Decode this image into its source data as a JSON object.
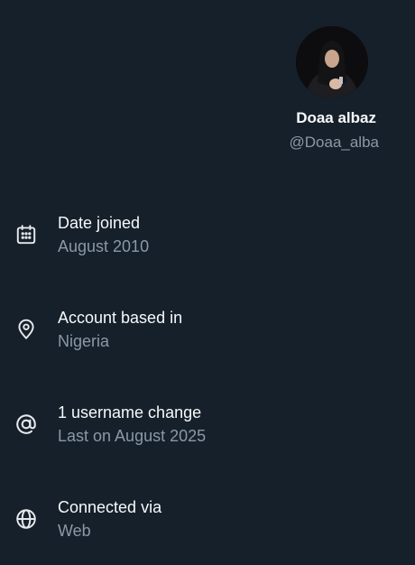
{
  "profile": {
    "display_name": "Doaa albaz",
    "handle": "@Doaa_alba"
  },
  "details": [
    {
      "icon": "calendar-icon",
      "label": "Date joined",
      "value": "August 2010"
    },
    {
      "icon": "location-pin-icon",
      "label": "Account based in",
      "value": "Nigeria"
    },
    {
      "icon": "at-sign-icon",
      "label": "1 username change",
      "value": "Last on August 2025"
    },
    {
      "icon": "globe-icon",
      "label": "Connected via",
      "value": "Web"
    }
  ],
  "colors": {
    "background": "#15202b",
    "primary_text": "#f7f9f9",
    "secondary_text": "#8b98a5"
  }
}
